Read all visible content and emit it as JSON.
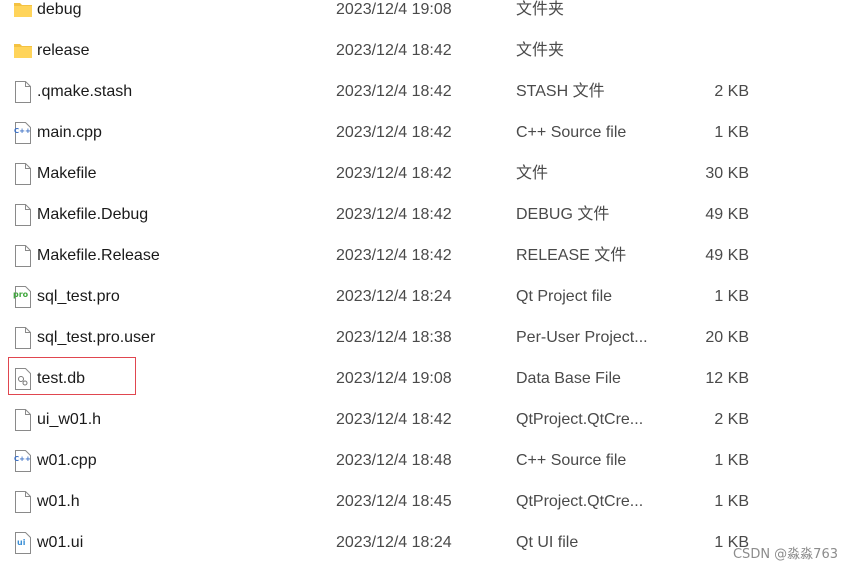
{
  "files": [
    {
      "name": "debug",
      "date": "2023/12/4 19:08",
      "type": "文件夹",
      "size": "",
      "icon": "folder-icon"
    },
    {
      "name": "release",
      "date": "2023/12/4 18:42",
      "type": "文件夹",
      "size": "",
      "icon": "folder-icon"
    },
    {
      "name": ".qmake.stash",
      "date": "2023/12/4 18:42",
      "type": "STASH 文件",
      "size": "2 KB",
      "icon": "blank-file-icon"
    },
    {
      "name": "main.cpp",
      "date": "2023/12/4 18:42",
      "type": "C++ Source file",
      "size": "1 KB",
      "icon": "cpp-file-icon"
    },
    {
      "name": "Makefile",
      "date": "2023/12/4 18:42",
      "type": "文件",
      "size": "30 KB",
      "icon": "blank-file-icon"
    },
    {
      "name": "Makefile.Debug",
      "date": "2023/12/4 18:42",
      "type": "DEBUG 文件",
      "size": "49 KB",
      "icon": "blank-file-icon"
    },
    {
      "name": "Makefile.Release",
      "date": "2023/12/4 18:42",
      "type": "RELEASE 文件",
      "size": "49 KB",
      "icon": "blank-file-icon"
    },
    {
      "name": "sql_test.pro",
      "date": "2023/12/4 18:24",
      "type": "Qt Project file",
      "size": "1 KB",
      "icon": "pro-file-icon"
    },
    {
      "name": "sql_test.pro.user",
      "date": "2023/12/4 18:38",
      "type": "Per-User Project...",
      "size": "20 KB",
      "icon": "blank-file-icon"
    },
    {
      "name": "test.db",
      "date": "2023/12/4 19:08",
      "type": "Data Base File",
      "size": "12 KB",
      "icon": "db-file-icon"
    },
    {
      "name": "ui_w01.h",
      "date": "2023/12/4 18:42",
      "type": "QtProject.QtCre...",
      "size": "2 KB",
      "icon": "blank-file-icon"
    },
    {
      "name": "w01.cpp",
      "date": "2023/12/4 18:48",
      "type": "C++ Source file",
      "size": "1 KB",
      "icon": "cpp-file-icon"
    },
    {
      "name": "w01.h",
      "date": "2023/12/4 18:45",
      "type": "QtProject.QtCre...",
      "size": "1 KB",
      "icon": "blank-file-icon"
    },
    {
      "name": "w01.ui",
      "date": "2023/12/4 18:24",
      "type": "Qt UI file",
      "size": "1 KB",
      "icon": "ui-file-icon"
    }
  ],
  "colors": {
    "folder": "#f4c242",
    "highlight": "#e0464f",
    "cpp": "#3b6fc4",
    "pro": "#41a83e",
    "ui": "#3b8fd6"
  },
  "watermark": "CSDN @淼淼763"
}
